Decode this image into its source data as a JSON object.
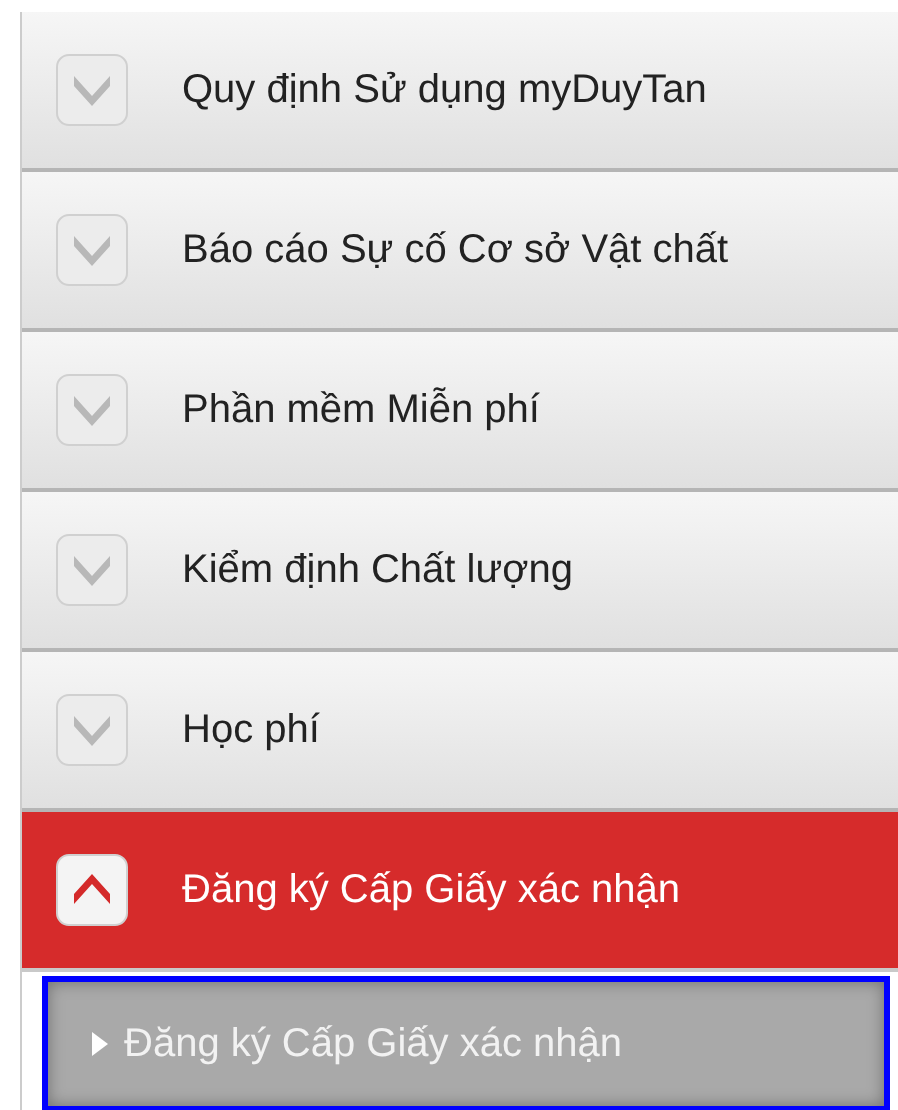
{
  "menu": [
    {
      "label": "Quy định Sử dụng myDuyTan",
      "expanded": false
    },
    {
      "label": "Báo cáo Sự cố Cơ sở Vật chất",
      "expanded": false
    },
    {
      "label": "Phần mềm Miễn phí",
      "expanded": false
    },
    {
      "label": "Kiểm định Chất lượng",
      "expanded": false
    },
    {
      "label": "Học phí",
      "expanded": false
    },
    {
      "label": "Đăng ký Cấp Giấy xác nhận",
      "expanded": true,
      "children": [
        {
          "label": "Đăng ký Cấp Giấy xác nhận",
          "selected": true
        }
      ]
    }
  ]
}
